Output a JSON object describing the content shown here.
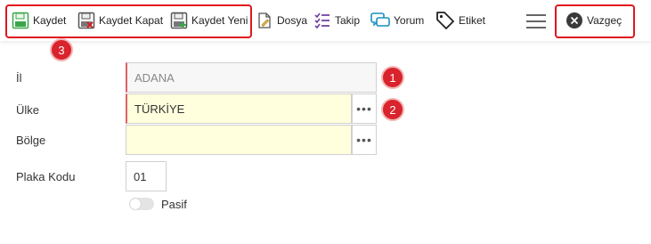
{
  "toolbar": {
    "save": "Kaydet",
    "save_close": "Kaydet Kapat",
    "save_new": "Kaydet Yeni",
    "file": "Dosya",
    "follow": "Takip",
    "comment": "Yorum",
    "tag": "Etiket",
    "cancel": "Vazgeç"
  },
  "badges": [
    "1",
    "2",
    "3"
  ],
  "form": {
    "province_label": "İl",
    "province_value": "ADANA",
    "country_label": "Ülke",
    "country_value": "TÜRKİYE",
    "region_label": "Bölge",
    "region_value": "",
    "plate_label": "Plaka Kodu",
    "plate_value": "01",
    "passive_label": "Pasif",
    "passive_on": false,
    "lookup_dots": "•••"
  },
  "colors": {
    "highlight_red": "#e0161e",
    "badge_red": "#d9232d",
    "required_yellow": "#ffffdd",
    "save_green": "#3aa64a",
    "icon_purple": "#6b3fa0",
    "icon_teal": "#1b8fc2"
  }
}
